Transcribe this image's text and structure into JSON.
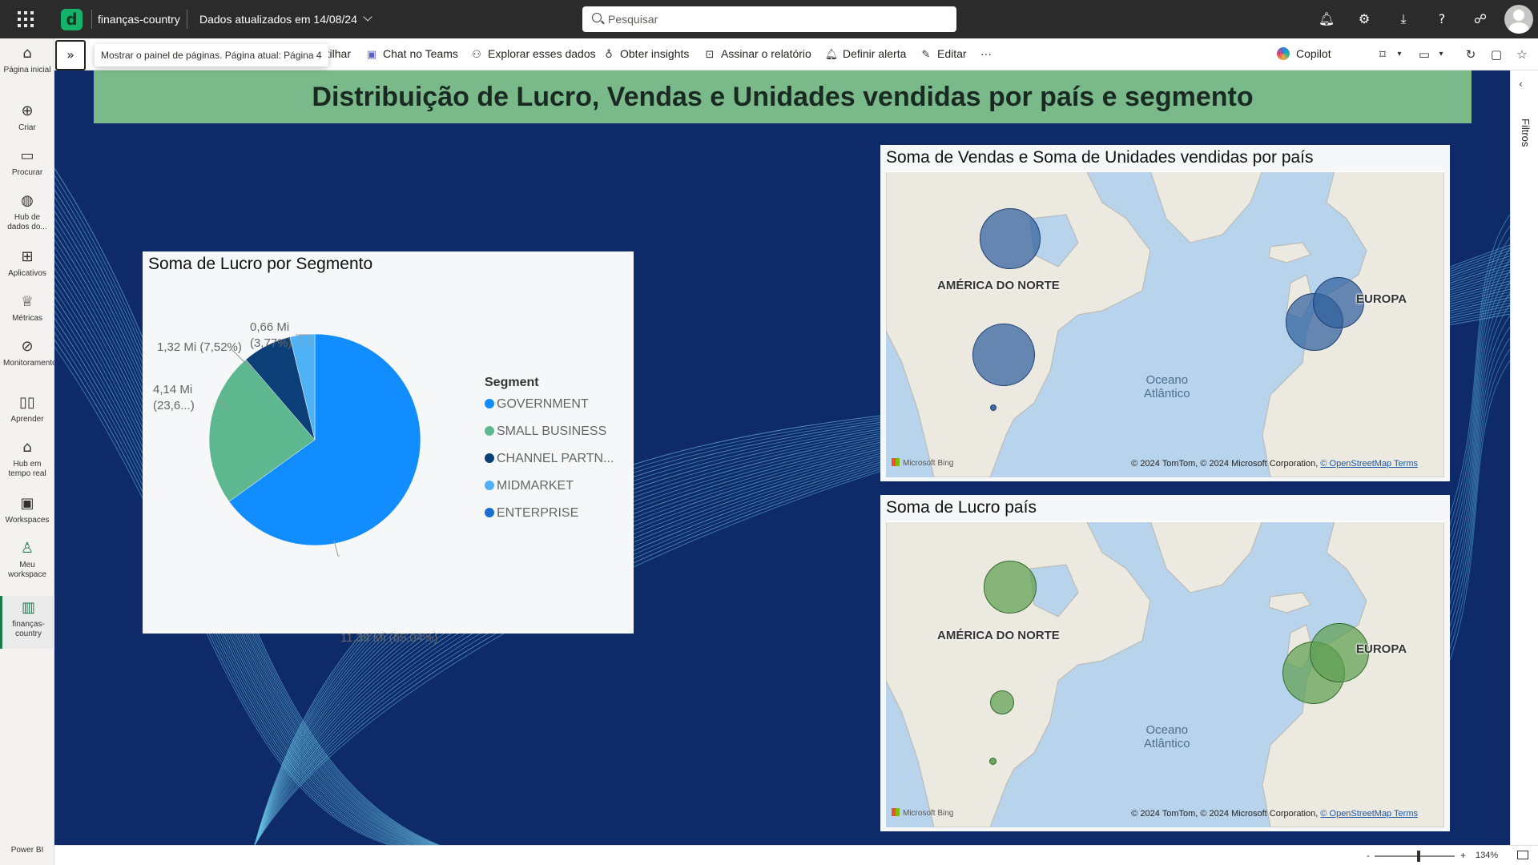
{
  "topbar": {
    "workspace": "finanças-country",
    "updated": "Dados atualizados em 14/08/24",
    "search_placeholder": "Pesquisar"
  },
  "nav": [
    {
      "label": "Página inicial",
      "icon": "home-icon"
    },
    {
      "label": "Criar",
      "icon": "create-icon"
    },
    {
      "label": "Procurar",
      "icon": "browse-icon"
    },
    {
      "label": "Hub de dados do...",
      "icon": "data-hub-icon"
    },
    {
      "label": "Aplicativos",
      "icon": "apps-icon"
    },
    {
      "label": "Métricas",
      "icon": "metrics-icon"
    },
    {
      "label": "Monitoramento",
      "icon": "monitoring-icon"
    },
    {
      "label": "Aprender",
      "icon": "learn-icon"
    },
    {
      "label": "Hub em tempo real",
      "icon": "realtime-hub-icon"
    },
    {
      "label": "Workspaces",
      "icon": "workspaces-icon"
    },
    {
      "label": "Meu workspace",
      "icon": "my-workspace-icon"
    },
    {
      "label": "finanças-country",
      "icon": "report-icon"
    }
  ],
  "brand": "Power BI",
  "actionbar": {
    "tooltip": "Mostrar o painel de páginas. Página atual: Página 4",
    "share_partial": "rtilhar",
    "teams": "Chat no Teams",
    "explore": "Explorar esses dados",
    "insights": "Obter insights",
    "subscribe": "Assinar o relatório",
    "alert": "Definir alerta",
    "edit": "Editar",
    "more": "···",
    "copilot": "Copilot"
  },
  "report": {
    "title": "Distribuição de Lucro, Vendas e Unidades vendidas por país e segmento",
    "pie": {
      "title": "Soma de Lucro por Segmento",
      "legend_title": "Segment",
      "legend": [
        "GOVERNMENT",
        "SMALL BUSINESS",
        "CHANNEL PARTN...",
        "MIDMARKET",
        "ENTERPRISE"
      ],
      "labels": [
        "11,39 Mi (65,04%)",
        "4,14 Mi (23,6...)",
        "1,32 Mi (7,52%)",
        "0,66 Mi (3,77%)"
      ],
      "label_lines": {
        "l1a": "4,14 Mi",
        "l1b": "(23,6...)",
        "l2": "1,32 Mi (7,52%)",
        "l3a": "0,66 Mi",
        "l3b": "(3,77%)"
      }
    },
    "map1": {
      "title": "Soma de Vendas e Soma de Unidades vendidas por país",
      "na": "AMÉRICA DO NORTE",
      "eu": "EUROPA",
      "ocean1": "Oceano",
      "ocean2": "Atlântico",
      "bing": "Microsoft Bing",
      "attr1": "© 2024 TomTom, © 2024 Microsoft Corporation, ",
      "attr2": "© OpenStreetMap",
      "attr3": " Terms"
    },
    "map2": {
      "title": "Soma de Lucro país",
      "na": "AMÉRICA DO NORTE",
      "eu": "EUROPA",
      "ocean1": "Oceano",
      "ocean2": "Atlântico",
      "bing": "Microsoft Bing",
      "attr1": "© 2024 TomTom, © 2024 Microsoft Corporation, ",
      "attr2": "© OpenStreetMap",
      "attr3": " Terms"
    }
  },
  "filters_label": "Filtros",
  "zoom": {
    "minus": "-",
    "plus": "+",
    "value": "134%"
  },
  "chart_data": {
    "type": "pie",
    "title": "Soma de Lucro por Segmento",
    "legend_title": "Segment",
    "slices": [
      {
        "name": "GOVERNMENT",
        "value": 11.39,
        "percent": 65.04,
        "color": "#118dff"
      },
      {
        "name": "SMALL BUSINESS",
        "value": 4.14,
        "percent": 23.6,
        "color": "#5eb88f"
      },
      {
        "name": "CHANNEL PARTN...",
        "value": 1.32,
        "percent": 7.52,
        "color": "#0c3f78"
      },
      {
        "name": "MIDMARKET",
        "value": 0.66,
        "percent": 3.77,
        "color": "#4fb2f7"
      }
    ],
    "legend_colors": [
      "#118dff",
      "#5eb88f",
      "#0c3f78",
      "#4fb2f7",
      "#1a6fd1"
    ]
  }
}
